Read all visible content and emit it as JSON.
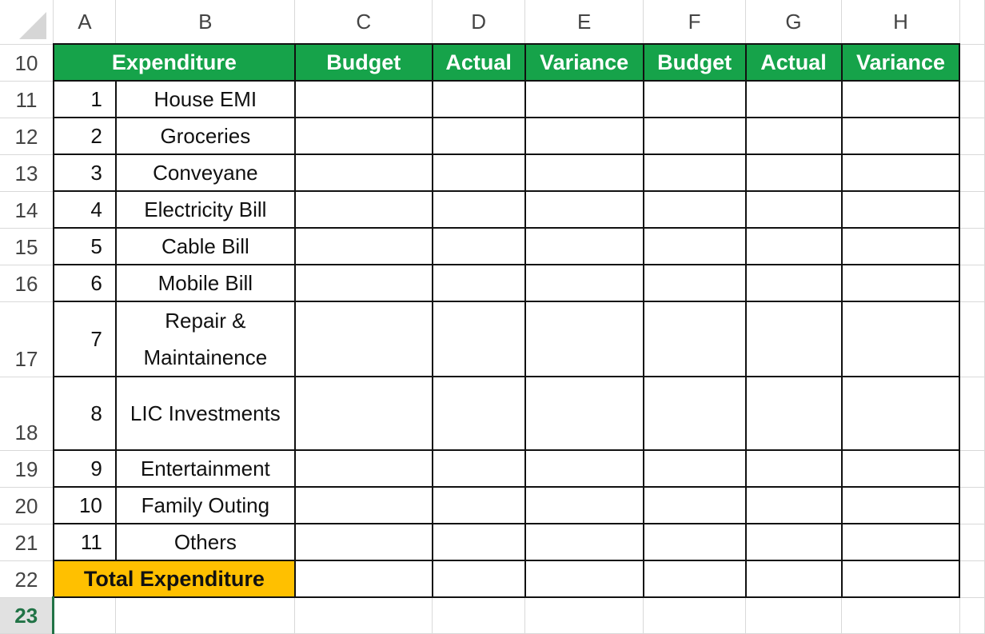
{
  "columns": [
    "A",
    "B",
    "C",
    "D",
    "E",
    "F",
    "G",
    "H"
  ],
  "header_row": {
    "row": "10",
    "expenditure": "Expenditure",
    "cols": [
      "Budget",
      "Actual",
      "Variance",
      "Budget",
      "Actual",
      "Variance"
    ]
  },
  "items": [
    {
      "row": "11",
      "no": "1",
      "name": "House EMI"
    },
    {
      "row": "12",
      "no": "2",
      "name": "Groceries"
    },
    {
      "row": "13",
      "no": "3",
      "name": "Conveyane"
    },
    {
      "row": "14",
      "no": "4",
      "name": "Electricity Bill"
    },
    {
      "row": "15",
      "no": "5",
      "name": "Cable Bill"
    },
    {
      "row": "16",
      "no": "6",
      "name": "Mobile Bill"
    },
    {
      "row": "17",
      "no": "7",
      "name": "Repair & Maintainence"
    },
    {
      "row": "18",
      "no": "8",
      "name": "LIC Investments"
    },
    {
      "row": "19",
      "no": "9",
      "name": "Entertainment"
    },
    {
      "row": "20",
      "no": "10",
      "name": "Family Outing"
    },
    {
      "row": "21",
      "no": "11",
      "name": "Others"
    }
  ],
  "total_row": {
    "row": "22",
    "label": "Total Expenditure"
  },
  "active_row": "23",
  "colors": {
    "header_green": "#16a34a",
    "total_gold": "#ffc000",
    "active_green": "#217346"
  }
}
